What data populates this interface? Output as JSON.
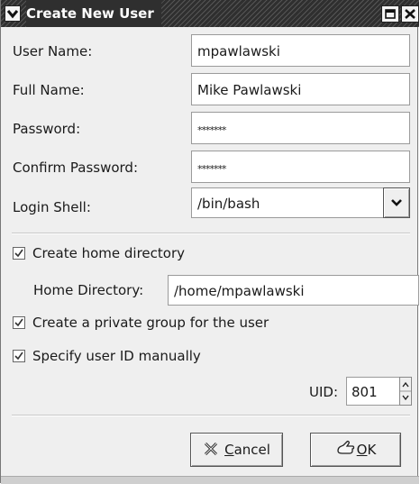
{
  "window": {
    "title": "Create New User"
  },
  "form": {
    "user_name_label": "User Name:",
    "user_name_value": "mpawlawski",
    "full_name_label": "Full Name:",
    "full_name_value": "Mike Pawlawski",
    "password_label": "Password:",
    "password_value": "*******",
    "confirm_password_label": "Confirm Password:",
    "confirm_password_value": "*******",
    "login_shell_label": "Login Shell:",
    "login_shell_value": "/bin/bash",
    "create_home_label": "Create home directory",
    "create_home_checked": true,
    "home_dir_label": "Home Directory:",
    "home_dir_value": "/home/mpawlawski",
    "private_group_label": "Create a private group for the user",
    "private_group_checked": true,
    "specify_uid_label": "Specify user ID manually",
    "specify_uid_checked": true,
    "uid_label": "UID:",
    "uid_value": "801"
  },
  "buttons": {
    "cancel_mnemonic": "C",
    "cancel_rest": "ancel",
    "ok_mnemonic": "O",
    "ok_rest": "K"
  },
  "icons": [
    "window-menu-icon",
    "maximize-icon",
    "close-icon",
    "dropdown-arrow-icon",
    "spin-up-icon",
    "spin-down-icon",
    "cancel-x-icon",
    "ok-hand-icon",
    "checkmark-icon"
  ]
}
